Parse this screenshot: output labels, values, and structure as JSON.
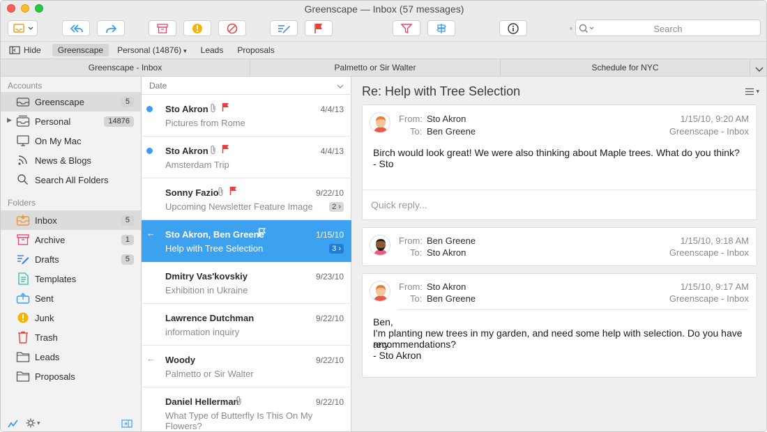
{
  "window": {
    "title": "Greenscape — Inbox (57 messages)"
  },
  "toolbar": {
    "search_placeholder": "Search"
  },
  "favorites": {
    "hide_label": "Hide",
    "items": [
      "Greenscape",
      "Personal (14876)",
      "Leads",
      "Proposals"
    ]
  },
  "tabs": [
    "Greenscape - Inbox",
    "Palmetto or Sir Walter",
    "Schedule for NYC"
  ],
  "sidebar": {
    "accounts_header": "Accounts",
    "accounts": [
      {
        "label": "Greenscape",
        "badge": "5"
      },
      {
        "label": "Personal",
        "badge": "14876"
      },
      {
        "label": "On My Mac"
      },
      {
        "label": "News & Blogs"
      },
      {
        "label": "Search All Folders"
      }
    ],
    "folders_header": "Folders",
    "folders": [
      {
        "label": "Inbox",
        "badge": "5"
      },
      {
        "label": "Archive",
        "badge": "1"
      },
      {
        "label": "Drafts",
        "badge": "5"
      },
      {
        "label": "Templates"
      },
      {
        "label": "Sent"
      },
      {
        "label": "Junk"
      },
      {
        "label": "Trash"
      },
      {
        "label": "Leads"
      },
      {
        "label": "Proposals"
      }
    ]
  },
  "list": {
    "sort_label": "Date",
    "messages": [
      {
        "from": "Sto Akron",
        "subject": "Pictures from Rome",
        "date": "4/4/13"
      },
      {
        "from": "Sto Akron",
        "subject": "Amsterdam Trip",
        "date": "4/4/13"
      },
      {
        "from": "Sonny Fazio",
        "subject": "Upcoming Newsletter Feature Image",
        "date": "9/22/10",
        "count": "2 ›"
      },
      {
        "from": "Sto Akron, Ben Greene",
        "subject": "Help with Tree Selection",
        "date": "1/15/10",
        "count": "3 ›"
      },
      {
        "from": "Dmitry Vas'kovskiy",
        "subject": "Exhibition in Ukraine",
        "date": "9/23/10"
      },
      {
        "from": "Lawrence Dutchman",
        "subject": "information inquiry",
        "date": "9/22/10"
      },
      {
        "from": "Woody",
        "subject": "Palmetto or Sir Walter",
        "date": "9/22/10"
      },
      {
        "from": "Daniel Hellerman",
        "subject": "What Type of Butterfly Is This On My Flowers?",
        "date": "9/22/10"
      }
    ]
  },
  "reader": {
    "subject": "Re: Help with Tree Selection",
    "from_label": "From:",
    "to_label": "To:",
    "quick_reply": "Quick reply...",
    "emails": [
      {
        "from": "Sto Akron",
        "to": "Ben Greene",
        "date": "1/15/10, 9:20 AM",
        "mailbox": "Greenscape - Inbox",
        "body": [
          "Birch would look great!  We were also thinking about Maple trees.  What do you think?",
          "- Sto"
        ]
      },
      {
        "from": "Ben Greene",
        "to": "Sto Akron",
        "date": "1/15/10, 9:18 AM",
        "mailbox": "Greenscape - Inbox"
      },
      {
        "from": "Sto Akron",
        "to": "Ben Greene",
        "date": "1/15/10, 9:17 AM",
        "mailbox": "Greenscape - Inbox",
        "body": [
          "Ben,",
          "I'm planting new trees in my garden, and need some help with selection.  Do you have any",
          "recommendations?",
          "- Sto Akron"
        ]
      }
    ]
  },
  "colors": {
    "accent": "#3ca2f0",
    "flag": "#e8413c",
    "sidebar_bg": "#f2f2f2",
    "reader_bg": "#efefef"
  }
}
